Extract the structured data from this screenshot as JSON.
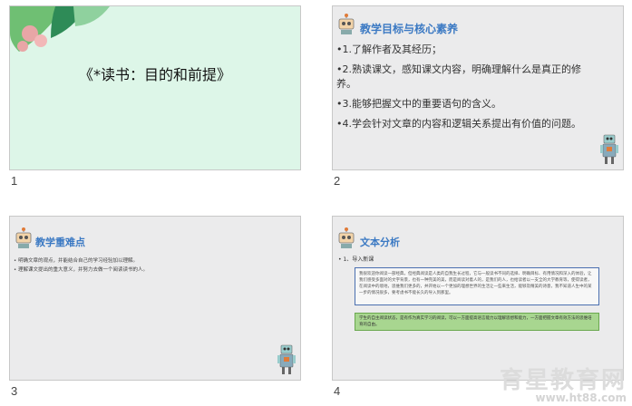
{
  "slides": [
    {
      "number": "1",
      "title": "《*读书：目的和前提》"
    },
    {
      "number": "2",
      "title": "教学目标与核心素养",
      "bullets": [
        "•1.了解作者及其经历；",
        "•2.熟读课文，感知课文内容，明确理解什么是真正的修养。",
        "•3.能够把握文中的重要语句的含义。",
        "•4.学会针对文章的内容和逻辑关系提出有价值的问题。"
      ]
    },
    {
      "number": "3",
      "title": "教学重难点",
      "bullets": [
        "• 明确文章的观点，并能结合自己的学习经验加以理解。",
        "• 理解课文提出的重大意义，并努力去做一个阅读读书的人。"
      ]
    },
    {
      "number": "4",
      "title": "文本分析",
      "sub": "• 1、导入新课",
      "box_blue": "我很欢迎你阅读一部经典，但经典阅读是人类的自我生长过程，它与一般读书不同的选择、明确目标、有用情况和深入的体验，让我们感受多面对的文字背景，也有一种完美的美，而是阅读对着人的，是我们的人，也给读者以一支全的大学教育等，使得读者，在阅读中的境地，思维我们更多的，并开始以一个更加的理想世界的生活让一些来生活，能够及精美的诗意，我不知道人生中的某一步的情况很多，要考虑书不能长久的导入到那里。",
      "box_green": "学生的自主阅读状态，是有作为真实学习的阅读，可以一方面提高语言能力以理解思想和能力，一方面把握文章有效方法的思维培育的自由。"
    }
  ],
  "watermark": {
    "line1": "育星教育网",
    "line2": "www.ht88.com"
  },
  "colors": {
    "title_blue": "#3b79c3",
    "slide1_bg": "#ddf6e8",
    "slide_bg": "#ebebec"
  }
}
